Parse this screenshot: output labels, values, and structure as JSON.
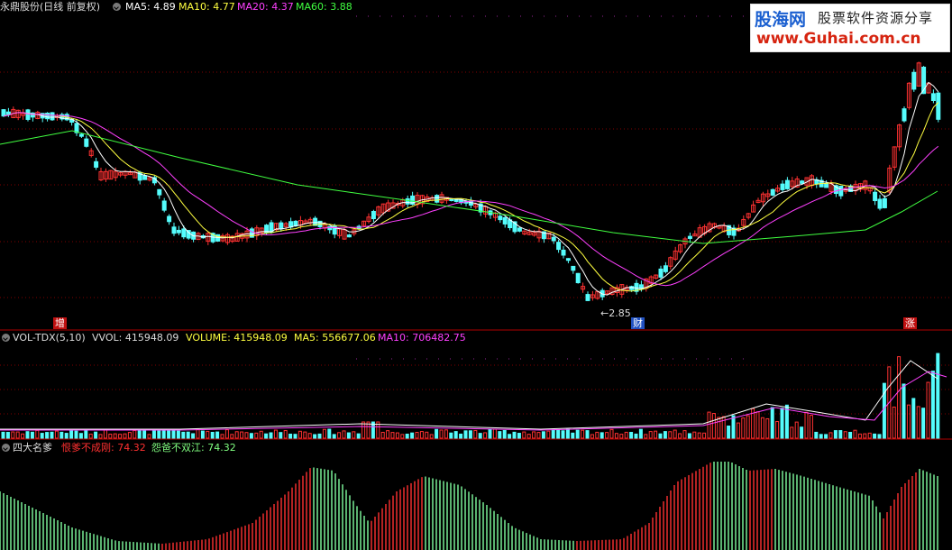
{
  "price_panel": {
    "title": "永鼎股份(日线 前复权)",
    "indicators": [
      {
        "label": "MA5: 4.89",
        "color": "#ffffff"
      },
      {
        "label": "MA10: 4.77",
        "color": "#ffff40"
      },
      {
        "label": "MA20: 4.37",
        "color": "#ff40ff"
      },
      {
        "label": "MA60: 3.88",
        "color": "#40ff40"
      }
    ],
    "low_label": "←2.85",
    "markers": [
      "增",
      "财",
      "涨"
    ]
  },
  "volume_panel": {
    "title": "VOL-TDX(5,10)",
    "vvol": "VVOL: 415948.09",
    "volume": "VOLUME: 415948.09",
    "ma5": "MA5: 556677.06",
    "ma10": "MA10: 706482.75"
  },
  "osc_panel": {
    "title": "四大名爹",
    "line1": "恨爹不成刚: 74.32",
    "line2": "怨爸不双江: 74.32"
  },
  "watermark": {
    "brand": "股海网",
    "slogan": "股票软件资源分享",
    "url": "www.Guhai.com.cn"
  },
  "colors": {
    "up": "#ff3232",
    "down": "#54fcfc",
    "ma5": "#ffffff",
    "ma10": "#ffff40",
    "ma20": "#ff40ff",
    "ma60": "#40ff40",
    "osc_up": "#ff3030",
    "osc_down": "#80ffa0"
  }
}
